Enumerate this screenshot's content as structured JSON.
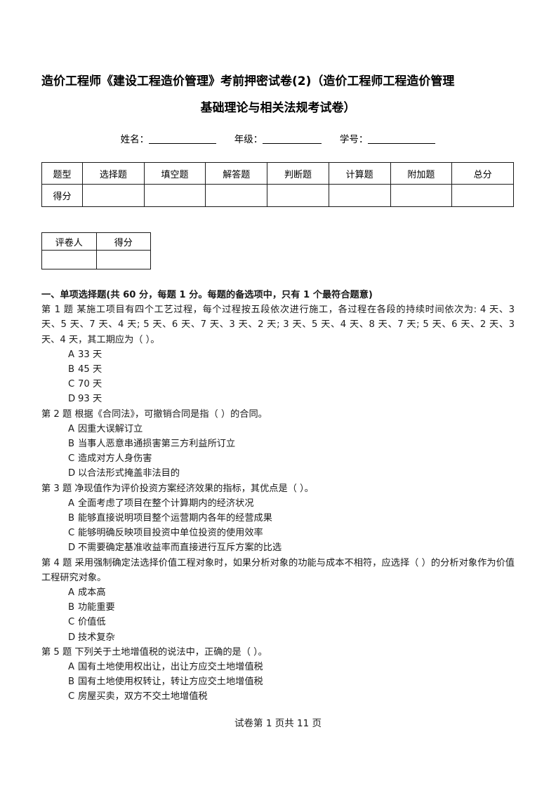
{
  "document": {
    "title_line1": "造价工程师《建设工程造价管理》考前押密试卷(2)（造价工程师工程造价管理",
    "title_line2": "基础理论与相关法规考试卷）"
  },
  "identity": {
    "name_label": "姓名：",
    "grade_label": "年级：",
    "student_id_label": "学号："
  },
  "score_table": {
    "headers": [
      "题型",
      "选择题",
      "填空题",
      "解答题",
      "判断题",
      "计算题",
      "附加题",
      "总分"
    ],
    "row_label": "得分",
    "values": [
      "",
      "",
      "",
      "",
      "",
      "",
      ""
    ]
  },
  "grader_table": {
    "headers": [
      "评卷人",
      "得分"
    ],
    "values": [
      "",
      ""
    ]
  },
  "section": {
    "heading": "一、单项选择题(共 60 分，每题 1 分。每题的备选项中，只有 1 个最符合题意)"
  },
  "questions": [
    {
      "stem": "第 1 题 某施工项目有四个工艺过程，每个过程按五段依次进行施工，各过程在各段的持续时间依次为: 4 天、3 天、5 天、7 天、4 天; 5 天、6 天、7 天、3 天、2 天; 3 天、5 天、4 天、8 天、7 天; 5 天、6 天、2 天、3 天、4 天，其工期应为（      ）。",
      "options": [
        {
          "letter": "A",
          "text": "33 天"
        },
        {
          "letter": "B",
          "text": "45 天"
        },
        {
          "letter": "C",
          "text": "70 天"
        },
        {
          "letter": "D",
          "text": "93 天"
        }
      ]
    },
    {
      "stem": "第 2 题 根据《合同法》，可撤销合同是指（      ）的合同。",
      "options": [
        {
          "letter": "A",
          "text": "因重大误解订立"
        },
        {
          "letter": "B",
          "text": "当事人恶意串通损害第三方利益所订立"
        },
        {
          "letter": "C",
          "text": "造成对方人身伤害"
        },
        {
          "letter": "D",
          "text": "以合法形式掩盖非法目的"
        }
      ]
    },
    {
      "stem": "第 3 题 净现值作为评价投资方案经济效果的指标，其优点是（   ）。",
      "options": [
        {
          "letter": "A",
          "text": "全面考虑了项目在整个计算期内的经济状况"
        },
        {
          "letter": "B",
          "text": "能够直接说明项目整个运营期内各年的经营成果"
        },
        {
          "letter": "C",
          "text": "能够明确反映项目投资中单位投资的使用效率"
        },
        {
          "letter": "D",
          "text": "不需要确定基准收益率而直接进行互斥方案的比选"
        }
      ]
    },
    {
      "stem": "第 4 题 采用强制确定法选择价值工程对象时，如果分析对象的功能与成本不相符，应选择（      ）的分析对象作为价值工程研究对象。",
      "options": [
        {
          "letter": "A",
          "text": "成本高"
        },
        {
          "letter": "B",
          "text": "功能重要"
        },
        {
          "letter": "C",
          "text": "价值低"
        },
        {
          "letter": "D",
          "text": "技术复杂"
        }
      ]
    },
    {
      "stem": "第 5 题 下列关于土地增值税的说法中，正确的是（   ）。",
      "options": [
        {
          "letter": "A",
          "text": "国有土地使用权出让，出让方应交土地增值税"
        },
        {
          "letter": "B",
          "text": "国有土地使用权转让，转让方应交土地增值税"
        },
        {
          "letter": "C",
          "text": "房屋买卖，双方不交土地增值税"
        }
      ]
    }
  ],
  "footer": {
    "text": "试卷第 1 页共 11 页"
  }
}
